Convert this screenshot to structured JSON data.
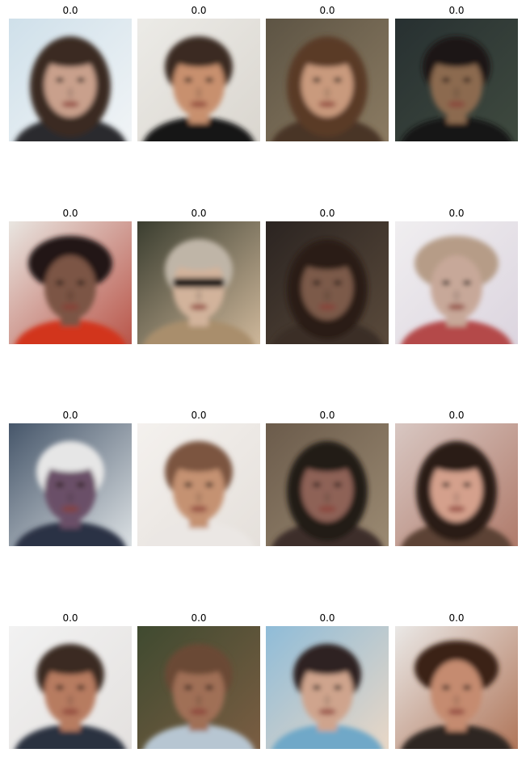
{
  "figure": {
    "panels": [
      {
        "title": "0.0",
        "bg": "#cfe0ea",
        "bg2": "#f1f4f6",
        "hair": "#3a2a22",
        "skin": "#c9a08c",
        "cloth": "#2b2b2f",
        "hair_style": "long",
        "accessory": "none"
      },
      {
        "title": "0.0",
        "bg": "#ecebe7",
        "bg2": "#dad6cf",
        "hair": "#3b2a22",
        "skin": "#c8906e",
        "cloth": "#151515",
        "hair_style": "short",
        "accessory": "none"
      },
      {
        "title": "0.0",
        "bg": "#5d5444",
        "bg2": "#8b7b62",
        "hair": "#5a3a26",
        "skin": "#c99a7d",
        "cloth": "#4a3428",
        "hair_style": "long",
        "accessory": "none"
      },
      {
        "title": "0.0",
        "bg": "#273031",
        "bg2": "#3f4a3f",
        "hair": "#1c1712",
        "skin": "#8c6a50",
        "cloth": "#141414",
        "hair_style": "short",
        "accessory": "none"
      },
      {
        "title": "0.0",
        "bg": "#e9e6e1",
        "bg2": "#b9564a",
        "hair": "#201717",
        "skin": "#7c5444",
        "cloth": "#d2351f",
        "hair_style": "hat",
        "accessory": "none"
      },
      {
        "title": "0.0",
        "bg": "#3a3d2f",
        "bg2": "#ceb79a",
        "hair": "#bfb5a7",
        "skin": "#d2b39b",
        "cloth": "#a98e6c",
        "hair_style": "short",
        "accessory": "sunglasses"
      },
      {
        "title": "0.0",
        "bg": "#2b2421",
        "bg2": "#5a4a3b",
        "hair": "#2a1d16",
        "skin": "#7b5a4a",
        "cloth": "#3a2d26",
        "hair_style": "long",
        "accessory": "none"
      },
      {
        "title": "0.0",
        "bg": "#f0eef0",
        "bg2": "#dcd5df",
        "hair": "#b69c87",
        "skin": "#c7a899",
        "cloth": "#b44a4a",
        "hair_style": "hat",
        "accessory": "none"
      },
      {
        "title": "0.0",
        "bg": "#46566a",
        "bg2": "#dbe0e3",
        "hair": "#e6e6e6",
        "skin": "#6b5068",
        "cloth": "#2b3344",
        "hair_style": "short",
        "accessory": "none"
      },
      {
        "title": "0.0",
        "bg": "#f4f1ee",
        "bg2": "#e5e0db",
        "hair": "#7b5540",
        "skin": "#c59272",
        "cloth": "#ebe7e4",
        "hair_style": "short",
        "accessory": "none"
      },
      {
        "title": "0.0",
        "bg": "#6b5b4b",
        "bg2": "#9b8a72",
        "hair": "#241a16",
        "skin": "#8e6256",
        "cloth": "#3c2f2a",
        "hair_style": "long",
        "accessory": "none"
      },
      {
        "title": "0.0",
        "bg": "#d8c7c2",
        "bg2": "#b07b6b",
        "hair": "#2a1a14",
        "skin": "#d4a08c",
        "cloth": "#5c4236",
        "hair_style": "long",
        "accessory": "none"
      },
      {
        "title": "0.0",
        "bg": "#f2f2f2",
        "bg2": "#e4e1df",
        "hair": "#3a2a22",
        "skin": "#b77b60",
        "cloth": "#2a3040",
        "hair_style": "short",
        "accessory": "none"
      },
      {
        "title": "0.0",
        "bg": "#3f4a30",
        "bg2": "#7a5d42",
        "hair": "#6b4a35",
        "skin": "#a07056",
        "cloth": "#b7c6d2",
        "hair_style": "short",
        "accessory": "none"
      },
      {
        "title": "0.0",
        "bg": "#8fbcd8",
        "bg2": "#e9d7c6",
        "hair": "#2d2220",
        "skin": "#cfa48d",
        "cloth": "#6fa8c8",
        "hair_style": "short",
        "accessory": "none"
      },
      {
        "title": "0.0",
        "bg": "#eae8e6",
        "bg2": "#b0765a",
        "hair": "#3a2417",
        "skin": "#c58b70",
        "cloth": "#2e2622",
        "hair_style": "hat",
        "accessory": "none"
      }
    ]
  }
}
